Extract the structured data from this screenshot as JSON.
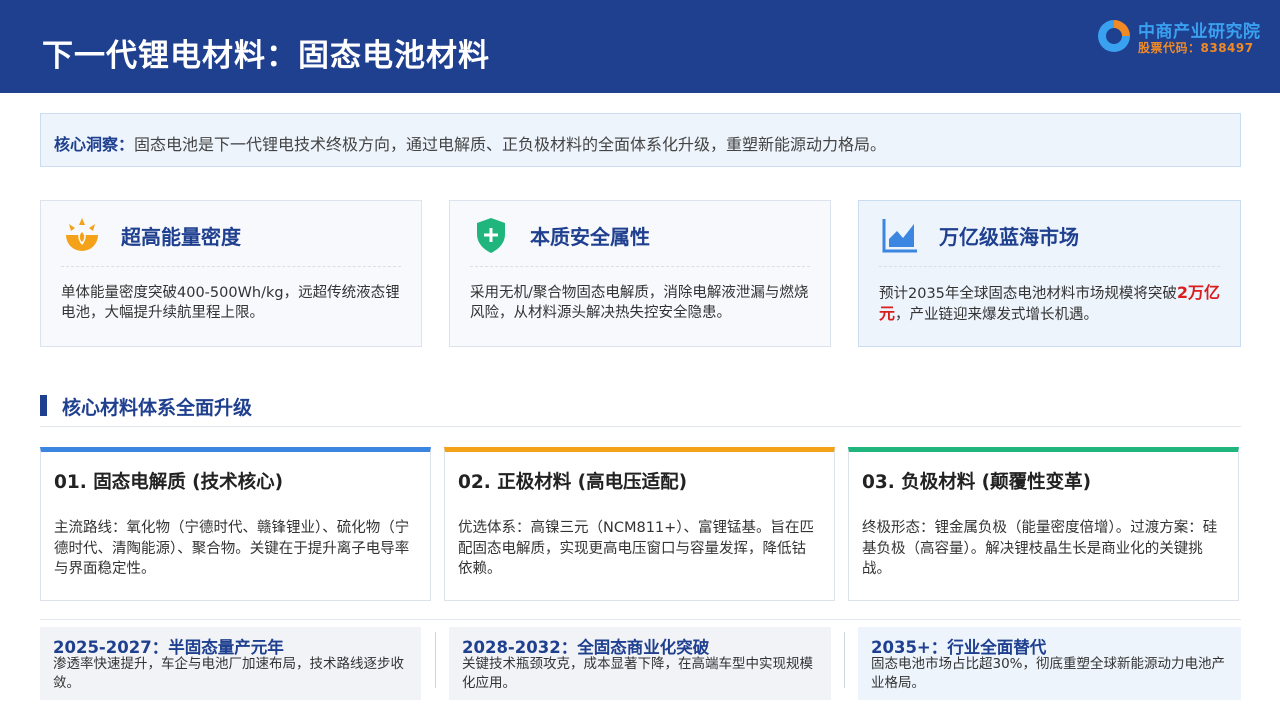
{
  "header": {
    "title": "下一代锂电材料：固态电池材料",
    "logo_name": "中商产业研究院",
    "logo_code": "股票代码：838497"
  },
  "insight": {
    "label": "核心洞察：",
    "text": "固态电池是下一代锂电技术终极方向，通过电解质、正负极材料的全面体系化升级，重塑新能源动力格局。"
  },
  "features": [
    {
      "icon": "sunrise-icon",
      "title": "超高能量密度",
      "desc": "单体能量密度突破400-500Wh/kg，远超传统液态锂电池，大幅提升续航里程上限。"
    },
    {
      "icon": "shield-plus-icon",
      "title": "本质安全属性",
      "desc": "采用无机/聚合物固态电解质，消除电解液泄漏与燃烧风险，从材料源头解决热失控安全隐患。"
    },
    {
      "icon": "area-chart-icon",
      "title": "万亿级蓝海市场",
      "desc_before": "预计2035年全球固态电池材料市场规模将突破",
      "desc_highlight": "2万亿元",
      "desc_after": "，产业链迎来爆发式增长机遇。"
    }
  ],
  "section": {
    "title": "核心材料体系全面升级"
  },
  "materials": [
    {
      "title": "01. 固态电解质 (技术核心)",
      "desc": "主流路线：氧化物（宁德时代、赣锋锂业）、硫化物（宁德时代、清陶能源）、聚合物。关键在于提升离子电导率与界面稳定性。"
    },
    {
      "title": "02. 正极材料 (高电压适配)",
      "desc": "优选体系：高镍三元（NCM811+）、富锂锰基。旨在匹配固态电解质，实现更高电压窗口与容量发挥，降低钴依赖。"
    },
    {
      "title": "03. 负极材料 (颠覆性变革)",
      "desc": "终极形态：锂金属负极（能量密度倍增）。过渡方案：硅基负极（高容量）。解决锂枝晶生长是商业化的关键挑战。"
    }
  ],
  "timeline": [
    {
      "title": "2025-2027：半固态量产元年",
      "desc": "渗透率快速提升，车企与电池厂加速布局，技术路线逐步收敛。"
    },
    {
      "title": "2028-2032：全固态商业化突破",
      "desc": "关键技术瓶颈攻克，成本显著下降，在高端车型中实现规模化应用。"
    },
    {
      "title": "2035+：行业全面替代",
      "desc": "固态电池市场占比超30%，彻底重塑全球新能源动力电池产业格局。"
    }
  ],
  "colors": {
    "brand_navy": "#1f3f8f",
    "accent_blue": "#3b86e0",
    "accent_orange": "#f5a21b",
    "accent_green": "#1fb57d",
    "highlight_red": "#d81e1e"
  }
}
